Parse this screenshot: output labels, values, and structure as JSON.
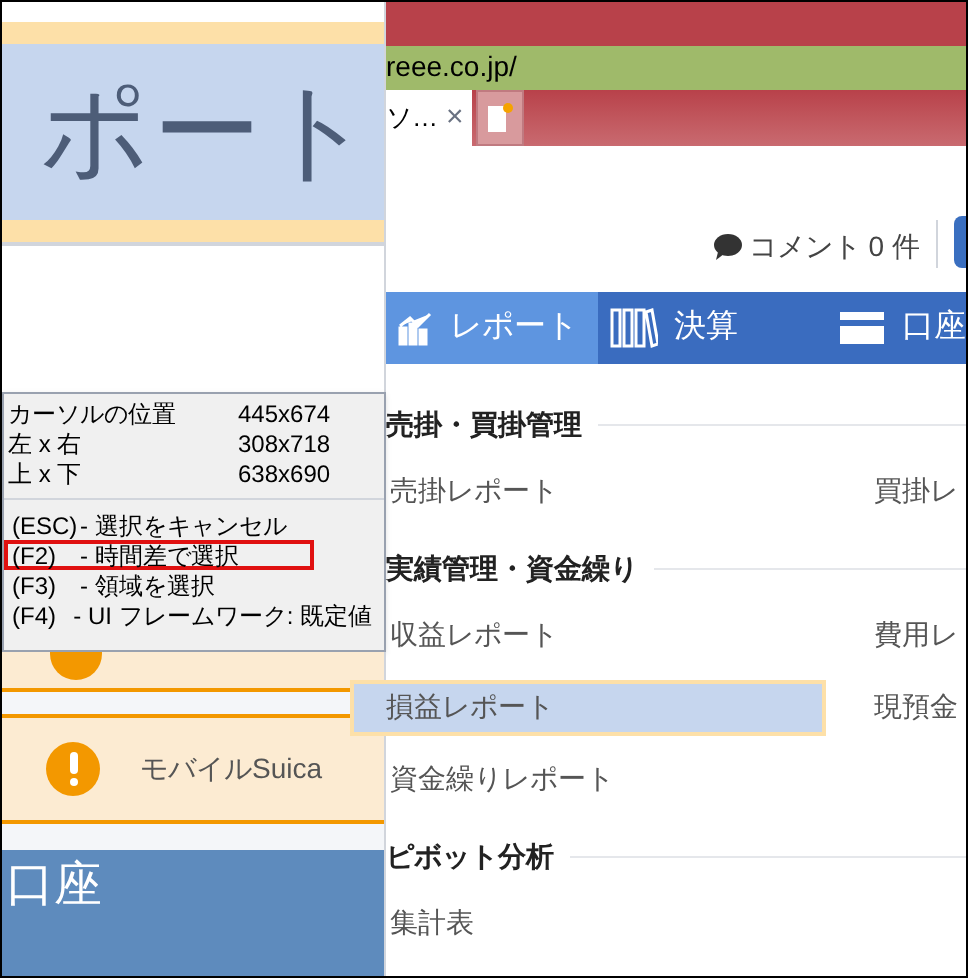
{
  "magnifier": {
    "text": "ポート"
  },
  "info_panel": {
    "rows": [
      {
        "label": "カーソルの位置",
        "value": "445x674"
      },
      {
        "label": "左 x 右",
        "value": "308x718"
      },
      {
        "label": "上 x 下",
        "value": "638x690"
      }
    ],
    "shortcuts": [
      {
        "key": "(ESC)",
        "action": "- 選択をキャンセル",
        "highlighted": false
      },
      {
        "key": "(F2)",
        "action": "- 時間差で選択",
        "highlighted": true
      },
      {
        "key": "(F3)",
        "action": "- 領域を選択",
        "highlighted": false
      },
      {
        "key": "(F4)",
        "action": "- UI フレームワーク: 既定値",
        "highlighted": false
      }
    ]
  },
  "left_page": {
    "alerts": [
      {
        "text": "モバイルSuica"
      }
    ],
    "account_heading": "口座"
  },
  "browser": {
    "address": "reee.co.jp/",
    "tab": {
      "title": "ソ…",
      "close": "×"
    }
  },
  "comment_count": "コメント 0 件",
  "nav": [
    {
      "label": "レポート",
      "kind": "chart",
      "selected": true
    },
    {
      "label": "決算",
      "kind": "books",
      "selected": false
    },
    {
      "label": "口座",
      "kind": "card",
      "selected": false
    }
  ],
  "sections": [
    {
      "heading": "売掛・買掛管理",
      "items": [
        {
          "label": "売掛レポート",
          "selected": false
        },
        {
          "label": "買掛レ",
          "selected": false
        }
      ]
    },
    {
      "heading": "実績管理・資金繰り",
      "items": [
        {
          "label": "収益レポート",
          "selected": false
        },
        {
          "label": "費用レ",
          "selected": false
        },
        {
          "label": "損益レポート",
          "selected": true
        },
        {
          "label": "現預金",
          "selected": false
        },
        {
          "label": "資金繰りレポート",
          "selected": false
        }
      ]
    },
    {
      "heading": "ピボット分析",
      "items": [
        {
          "label": "集計表",
          "selected": false
        }
      ]
    }
  ]
}
